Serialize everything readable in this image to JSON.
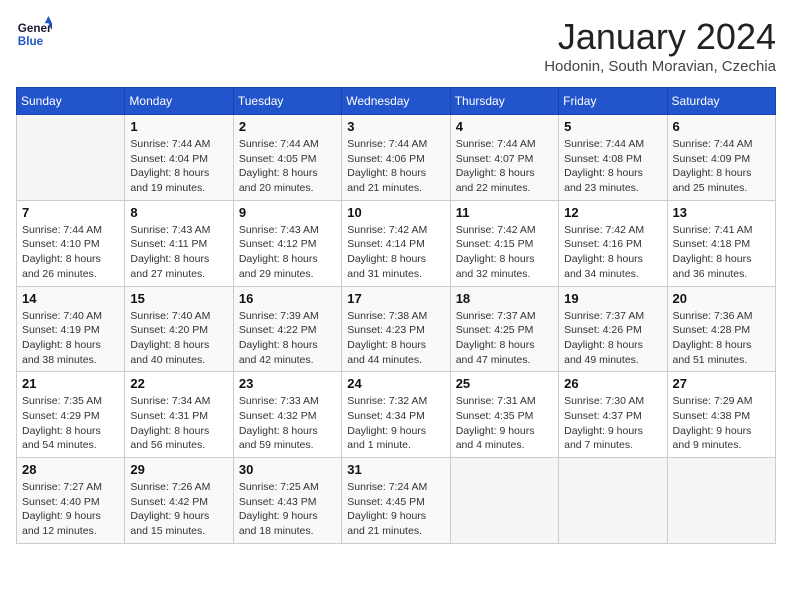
{
  "header": {
    "logo_line1": "General",
    "logo_line2": "Blue",
    "title": "January 2024",
    "subtitle": "Hodonin, South Moravian, Czechia"
  },
  "weekdays": [
    "Sunday",
    "Monday",
    "Tuesday",
    "Wednesday",
    "Thursday",
    "Friday",
    "Saturday"
  ],
  "weeks": [
    [
      {
        "day": "",
        "info": ""
      },
      {
        "day": "1",
        "info": "Sunrise: 7:44 AM\nSunset: 4:04 PM\nDaylight: 8 hours\nand 19 minutes."
      },
      {
        "day": "2",
        "info": "Sunrise: 7:44 AM\nSunset: 4:05 PM\nDaylight: 8 hours\nand 20 minutes."
      },
      {
        "day": "3",
        "info": "Sunrise: 7:44 AM\nSunset: 4:06 PM\nDaylight: 8 hours\nand 21 minutes."
      },
      {
        "day": "4",
        "info": "Sunrise: 7:44 AM\nSunset: 4:07 PM\nDaylight: 8 hours\nand 22 minutes."
      },
      {
        "day": "5",
        "info": "Sunrise: 7:44 AM\nSunset: 4:08 PM\nDaylight: 8 hours\nand 23 minutes."
      },
      {
        "day": "6",
        "info": "Sunrise: 7:44 AM\nSunset: 4:09 PM\nDaylight: 8 hours\nand 25 minutes."
      }
    ],
    [
      {
        "day": "7",
        "info": "Sunrise: 7:44 AM\nSunset: 4:10 PM\nDaylight: 8 hours\nand 26 minutes."
      },
      {
        "day": "8",
        "info": "Sunrise: 7:43 AM\nSunset: 4:11 PM\nDaylight: 8 hours\nand 27 minutes."
      },
      {
        "day": "9",
        "info": "Sunrise: 7:43 AM\nSunset: 4:12 PM\nDaylight: 8 hours\nand 29 minutes."
      },
      {
        "day": "10",
        "info": "Sunrise: 7:42 AM\nSunset: 4:14 PM\nDaylight: 8 hours\nand 31 minutes."
      },
      {
        "day": "11",
        "info": "Sunrise: 7:42 AM\nSunset: 4:15 PM\nDaylight: 8 hours\nand 32 minutes."
      },
      {
        "day": "12",
        "info": "Sunrise: 7:42 AM\nSunset: 4:16 PM\nDaylight: 8 hours\nand 34 minutes."
      },
      {
        "day": "13",
        "info": "Sunrise: 7:41 AM\nSunset: 4:18 PM\nDaylight: 8 hours\nand 36 minutes."
      }
    ],
    [
      {
        "day": "14",
        "info": "Sunrise: 7:40 AM\nSunset: 4:19 PM\nDaylight: 8 hours\nand 38 minutes."
      },
      {
        "day": "15",
        "info": "Sunrise: 7:40 AM\nSunset: 4:20 PM\nDaylight: 8 hours\nand 40 minutes."
      },
      {
        "day": "16",
        "info": "Sunrise: 7:39 AM\nSunset: 4:22 PM\nDaylight: 8 hours\nand 42 minutes."
      },
      {
        "day": "17",
        "info": "Sunrise: 7:38 AM\nSunset: 4:23 PM\nDaylight: 8 hours\nand 44 minutes."
      },
      {
        "day": "18",
        "info": "Sunrise: 7:37 AM\nSunset: 4:25 PM\nDaylight: 8 hours\nand 47 minutes."
      },
      {
        "day": "19",
        "info": "Sunrise: 7:37 AM\nSunset: 4:26 PM\nDaylight: 8 hours\nand 49 minutes."
      },
      {
        "day": "20",
        "info": "Sunrise: 7:36 AM\nSunset: 4:28 PM\nDaylight: 8 hours\nand 51 minutes."
      }
    ],
    [
      {
        "day": "21",
        "info": "Sunrise: 7:35 AM\nSunset: 4:29 PM\nDaylight: 8 hours\nand 54 minutes."
      },
      {
        "day": "22",
        "info": "Sunrise: 7:34 AM\nSunset: 4:31 PM\nDaylight: 8 hours\nand 56 minutes."
      },
      {
        "day": "23",
        "info": "Sunrise: 7:33 AM\nSunset: 4:32 PM\nDaylight: 8 hours\nand 59 minutes."
      },
      {
        "day": "24",
        "info": "Sunrise: 7:32 AM\nSunset: 4:34 PM\nDaylight: 9 hours\nand 1 minute."
      },
      {
        "day": "25",
        "info": "Sunrise: 7:31 AM\nSunset: 4:35 PM\nDaylight: 9 hours\nand 4 minutes."
      },
      {
        "day": "26",
        "info": "Sunrise: 7:30 AM\nSunset: 4:37 PM\nDaylight: 9 hours\nand 7 minutes."
      },
      {
        "day": "27",
        "info": "Sunrise: 7:29 AM\nSunset: 4:38 PM\nDaylight: 9 hours\nand 9 minutes."
      }
    ],
    [
      {
        "day": "28",
        "info": "Sunrise: 7:27 AM\nSunset: 4:40 PM\nDaylight: 9 hours\nand 12 minutes."
      },
      {
        "day": "29",
        "info": "Sunrise: 7:26 AM\nSunset: 4:42 PM\nDaylight: 9 hours\nand 15 minutes."
      },
      {
        "day": "30",
        "info": "Sunrise: 7:25 AM\nSunset: 4:43 PM\nDaylight: 9 hours\nand 18 minutes."
      },
      {
        "day": "31",
        "info": "Sunrise: 7:24 AM\nSunset: 4:45 PM\nDaylight: 9 hours\nand 21 minutes."
      },
      {
        "day": "",
        "info": ""
      },
      {
        "day": "",
        "info": ""
      },
      {
        "day": "",
        "info": ""
      }
    ]
  ]
}
